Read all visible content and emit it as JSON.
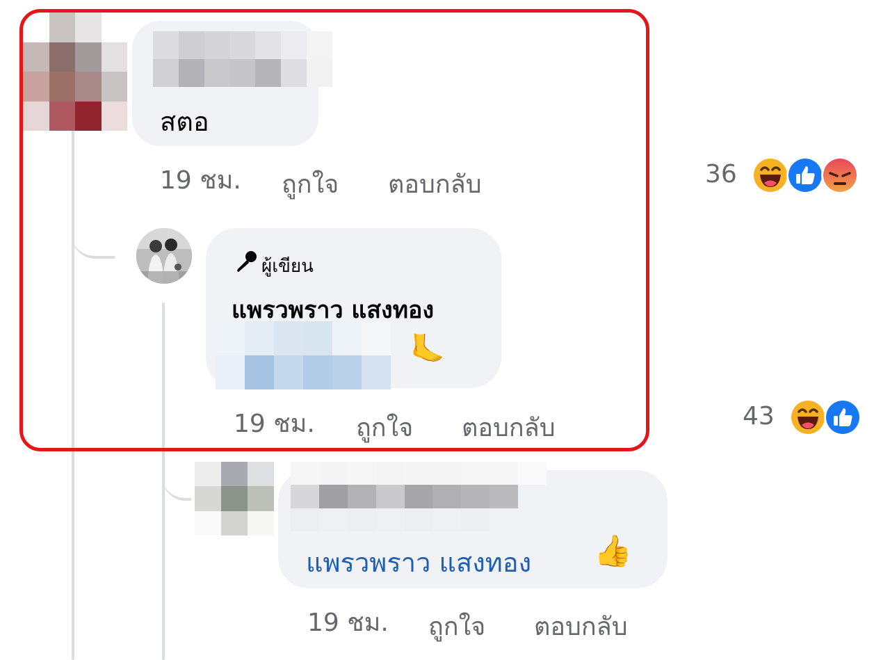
{
  "comments": [
    {
      "text": "สตอ",
      "time": "19 ชม.",
      "like_label": "ถูกใจ",
      "reply_label": "ตอบกลับ",
      "reaction_count": "36",
      "reactions": [
        "haha-icon",
        "like-icon",
        "angry-icon"
      ]
    },
    {
      "badge": "ผู้เขียน",
      "author": "แพรวพราว แสงทอง",
      "emoji": "🦶",
      "time": "19 ชม.",
      "like_label": "ถูกใจ",
      "reply_label": "ตอบกลับ",
      "reaction_count": "43",
      "reactions": [
        "haha-icon",
        "like-icon"
      ]
    },
    {
      "mention": "แพรวพราว แสงทอง",
      "emoji": "👍",
      "time": "19 ชม.",
      "like_label": "ถูกใจ",
      "reply_label": "ตอบกลับ"
    }
  ],
  "colors": {
    "highlight_frame": "#e4161a",
    "bubble_bg": "#f0f2f5",
    "meta_text": "#65676b",
    "mention_blue": "#1d5fb0",
    "like_blue": "#1877f2",
    "haha_yellow": "#f7b125",
    "angry_orange": "#e9710f"
  }
}
